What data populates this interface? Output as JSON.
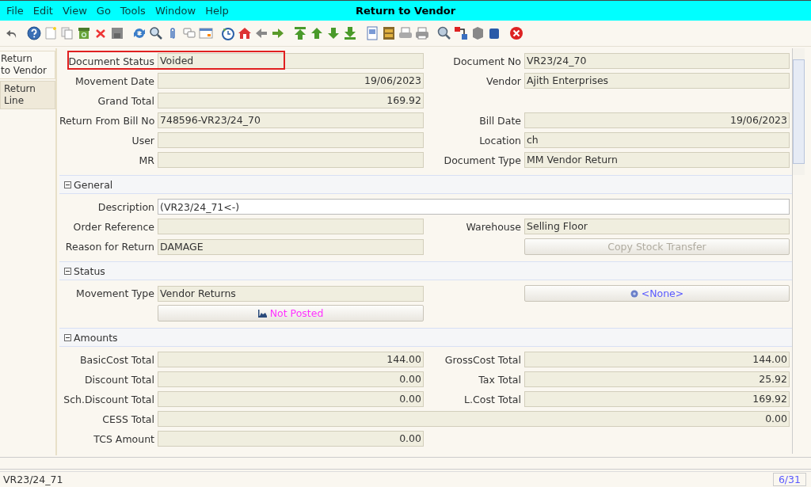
{
  "window": {
    "title": "Return to Vendor"
  },
  "menu": [
    {
      "label": "File"
    },
    {
      "label": "Edit"
    },
    {
      "label": "View"
    },
    {
      "label": "Go"
    },
    {
      "label": "Tools"
    },
    {
      "label": "Window"
    },
    {
      "label": "Help"
    }
  ],
  "tabs": [
    {
      "label": "Return\nto Vendor",
      "selected": true
    },
    {
      "label": "Return Line",
      "selected": false
    }
  ],
  "header": {
    "rows": [
      [
        {
          "kind": "text",
          "label": "Document Status",
          "value": "Voided",
          "highlighted": true
        },
        {
          "kind": "text",
          "label": "Document No",
          "value": "VR23/24_70"
        }
      ],
      [
        {
          "kind": "number",
          "label": "Movement Date",
          "value": "19/06/2023"
        },
        {
          "kind": "text",
          "label": "Vendor",
          "value": "Ajith Enterprises"
        }
      ],
      [
        {
          "kind": "number",
          "label": "Grand Total",
          "value": "169.92"
        },
        {
          "kind": "blank"
        }
      ],
      [
        {
          "kind": "text",
          "label": "Return From Bill No",
          "value": "748596-VR23/24_70"
        },
        {
          "kind": "number",
          "label": "Bill Date",
          "value": "19/06/2023"
        }
      ],
      [
        {
          "kind": "text",
          "label": "User"
        },
        {
          "kind": "text",
          "label": "Location",
          "value": "ch"
        }
      ],
      [
        {
          "kind": "text",
          "label": "MR"
        },
        {
          "kind": "text",
          "label": "Document Type",
          "value": "MM Vendor Return"
        }
      ]
    ]
  },
  "sections": [
    {
      "title": "General",
      "expanded": true,
      "rows": [
        [
          {
            "kind": "input",
            "label": "Description",
            "value": "(VR23/24_71<-)"
          }
        ],
        [
          {
            "kind": "text",
            "label": "Order Reference"
          },
          {
            "kind": "text",
            "label": "Warehouse",
            "value": "Selling Floor"
          }
        ],
        [
          {
            "kind": "text",
            "label": "Reason for Return",
            "value": "DAMAGE"
          },
          {
            "kind": "button",
            "label": "Copy Stock Transfer",
            "disabled": true
          }
        ]
      ]
    },
    {
      "title": "Status",
      "expanded": true,
      "rows": [
        [
          {
            "kind": "text",
            "label": "Movement Type",
            "value": "Vendor Returns"
          },
          {
            "kind": "chooser",
            "label": "<None>",
            "color": "#5a5aff"
          }
        ],
        [
          {
            "kind": "posting",
            "label": "Not Posted",
            "color": "#ff33ff"
          },
          {
            "kind": "blank"
          }
        ]
      ]
    },
    {
      "title": "Amounts",
      "expanded": true,
      "rows": [
        [
          {
            "kind": "number",
            "label": "BasicCost Total",
            "value": "144.00"
          },
          {
            "kind": "number",
            "label": "GrossCost Total",
            "value": "144.00"
          }
        ],
        [
          {
            "kind": "number",
            "label": "Discount Total",
            "value": "0.00"
          },
          {
            "kind": "number",
            "label": "Tax Total",
            "value": "25.92"
          }
        ],
        [
          {
            "kind": "number",
            "label": "Sch.Discount Total",
            "value": "0.00"
          },
          {
            "kind": "number",
            "label": "L.Cost Total",
            "value": "169.92"
          }
        ],
        [
          {
            "kind": "number",
            "label": "CESS Total",
            "value": "0.00"
          }
        ],
        [
          {
            "kind": "number",
            "label": "TCS Amount",
            "value": "0.00"
          },
          {
            "kind": "blank"
          }
        ]
      ]
    }
  ],
  "status_bar": {
    "text": "VR23/24_71",
    "record": "6/31"
  }
}
